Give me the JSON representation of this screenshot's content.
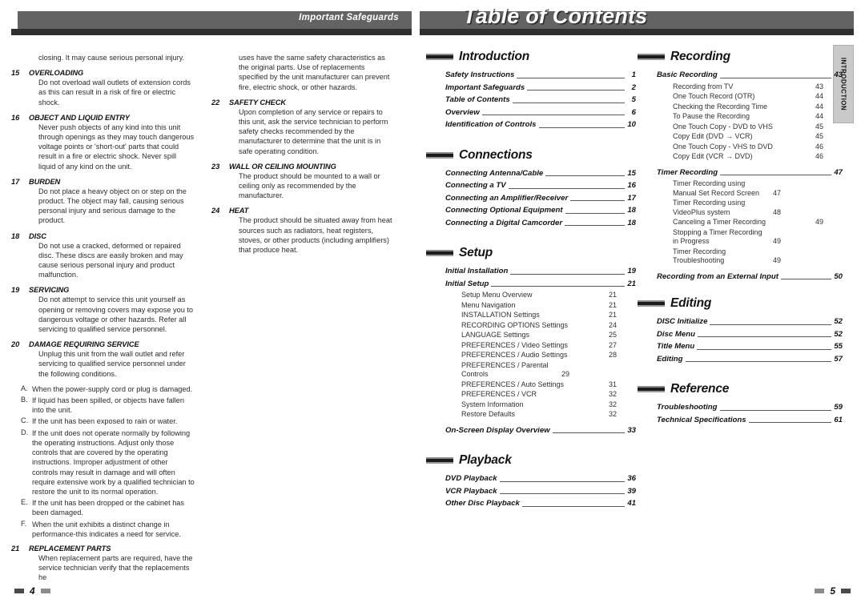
{
  "headers": {
    "left_title": "Important Safeguards",
    "right_title": "Table of Contents"
  },
  "side_tab": {
    "label": "INTRODUCTION"
  },
  "footers": {
    "left_page": "4",
    "right_page": "5"
  },
  "safeguards": {
    "col1": {
      "intro_text": "closing. It may cause serious personal injury.",
      "items": [
        {
          "num": "15",
          "head": "OVERLOADING",
          "body": "Do not overload wall outlets of extension cords as this can result in a risk of fire or electric shock."
        },
        {
          "num": "16",
          "head": "OBJECT AND LIQUID ENTRY",
          "body": "Never push objects of any kind into this unit through openings as they may touch dangerous voltage points or 'short-out' parts that could result in a fire or electric shock. Never spill liquid of any kind on the unit."
        },
        {
          "num": "17",
          "head": "BURDEN",
          "body": "Do not place a heavy object on or step on the product. The object may fall, causing serious personal injury and serious damage to the product."
        },
        {
          "num": "18",
          "head": "DISC",
          "body": "Do not use a cracked, deformed or repaired disc. These discs are easily broken and may cause serious personal injury and product malfunction."
        },
        {
          "num": "19",
          "head": "SERVICING",
          "body": "Do not attempt to service this unit yourself as opening or removing covers may expose you to dangerous voltage or other hazards. Refer all servicing to qualified service personnel."
        },
        {
          "num": "20",
          "head": "DAMAGE REQUIRING SERVICE",
          "body": "Unplug this unit from the wall outlet and refer servicing to qualified service personnel under the following conditions."
        }
      ],
      "sub_items": [
        {
          "letter": "A.",
          "text": "When the power-supply cord or plug is damaged."
        },
        {
          "letter": "B.",
          "text": "If liquid has been spilled, or objects have fallen into the unit."
        },
        {
          "letter": "C.",
          "text": "If the unit has been exposed to rain or water."
        },
        {
          "letter": "D.",
          "text": "If the unit does not operate normally by following the operating instructions. Adjust only those controls that are covered by the operating instructions. Improper adjustment of other controls may result in damage and will often require extensive work by a qualified technician to restore the unit to its normal operation."
        },
        {
          "letter": "E.",
          "text": "If the unit has been dropped or the cabinet has been damaged."
        },
        {
          "letter": "F.",
          "text": "When the unit exhibits a distinct change in performance-this indicates a need for service."
        }
      ],
      "last_item": {
        "num": "21",
        "head": "REPLACEMENT PARTS",
        "body": "When replacement parts are required, have the service technician verify that the replacements he"
      }
    },
    "col2": {
      "intro_text": "uses have the same safety characteristics as the original parts. Use of replacements specified by the unit manufacturer can prevent fire, electric shock, or other hazards.",
      "items": [
        {
          "num": "22",
          "head": "SAFETY CHECK",
          "body": "Upon completion of any service or repairs to this unit, ask the service technician to perform safety checks recommended by the manufacturer to determine that the unit is in safe operating condition."
        },
        {
          "num": "23",
          "head": "WALL OR CEILING MOUNTING",
          "body": "The product should be mounted to a wall or ceiling only as recommended by the manufacturer."
        },
        {
          "num": "24",
          "head": "HEAT",
          "body": "The product should be situated away from heat sources such as radiators, heat registers, stoves, or other products (including amplifiers) that produce heat."
        }
      ]
    }
  },
  "toc": {
    "sections": [
      {
        "title": "Introduction",
        "entries": [
          {
            "label": "Safety Instructions",
            "page": "1"
          },
          {
            "label": "Important Safeguards",
            "page": "2"
          },
          {
            "label": "Table of Contents",
            "page": "5"
          },
          {
            "label": "Overview",
            "page": "6"
          },
          {
            "label": "Identification of Controls",
            "page": "10"
          }
        ]
      },
      {
        "title": "Connections",
        "entries": [
          {
            "label": "Connecting Antenna/Cable",
            "page": "15"
          },
          {
            "label": "Connecting a TV",
            "page": "16"
          },
          {
            "label": "Connecting an Amplifier/Receiver",
            "page": "17"
          },
          {
            "label": "Connecting Optional Equipment",
            "page": "18"
          },
          {
            "label": "Connecting a Digital Camcorder",
            "page": "18"
          }
        ]
      },
      {
        "title": "Setup",
        "entries": [
          {
            "label": "Initial Installation",
            "page": "19"
          },
          {
            "label": "Initial Setup",
            "page": "21"
          }
        ],
        "subentries": [
          {
            "label": "Setup Menu Overview",
            "page": "21"
          },
          {
            "label": "Menu Navigation",
            "page": "21"
          },
          {
            "label": "INSTALLATION Settings",
            "page": "21"
          },
          {
            "label": "RECORDING OPTIONS Settings",
            "page": "24"
          },
          {
            "label": "LANGUAGE Settings",
            "page": "25"
          },
          {
            "label": "PREFERENCES / Video Settings",
            "page": "27"
          },
          {
            "label": "PREFERENCES / Audio Settings",
            "page": "28"
          },
          {
            "label": "PREFERENCES / Parental Controls",
            "page": "29"
          },
          {
            "label": "PREFERENCES / Auto Settings",
            "page": "31"
          },
          {
            "label": "PREFERENCES / VCR",
            "page": "32"
          },
          {
            "label": "System Information",
            "page": "32"
          },
          {
            "label": "Restore Defaults",
            "page": "32"
          }
        ],
        "trailing_entries": [
          {
            "label": "On-Screen Display Overview",
            "page": "33"
          }
        ]
      },
      {
        "title": "Playback",
        "entries": [
          {
            "label": "DVD Playback",
            "page": "36"
          },
          {
            "label": "VCR Playback",
            "page": "39"
          },
          {
            "label": "Other Disc Playback",
            "page": "41"
          }
        ]
      },
      {
        "title": "Recording",
        "entries": [
          {
            "label": "Basic Recording",
            "page": "43"
          }
        ],
        "subentries": [
          {
            "label": "Recording from TV",
            "page": "43"
          },
          {
            "label": "One Touch Record (OTR)",
            "page": "44"
          },
          {
            "label": "Checking the Recording Time",
            "page": "44"
          },
          {
            "label": "To Pause the Recording",
            "page": "44"
          },
          {
            "label": "One Touch Copy - DVD to VHS",
            "page": "45"
          },
          {
            "label": "Copy Edit (DVD → VCR)",
            "page": "45"
          },
          {
            "label": "One Touch Copy - VHS to DVD",
            "page": "46"
          },
          {
            "label": "Copy Edit (VCR → DVD)",
            "page": "46"
          }
        ],
        "entries2": [
          {
            "label": "Timer Recording",
            "page": "47"
          }
        ],
        "subentries2": [
          {
            "label": "Timer Recording using Manual Set Record Screen",
            "page": "47"
          },
          {
            "label": "Timer Recording using VideoPlus system",
            "page": "48"
          },
          {
            "label": "Canceling a Timer Recording",
            "page": "49"
          },
          {
            "label": "Stopping a Timer Recording in Progress",
            "page": "49"
          },
          {
            "label": "Timer Recording Troubleshooting",
            "page": "49"
          }
        ],
        "trailing_entries": [
          {
            "label": "Recording from an External Input",
            "page": "50"
          }
        ]
      },
      {
        "title": "Editing",
        "entries": [
          {
            "label": "DISC Initialize",
            "page": "52"
          },
          {
            "label": "Disc Menu",
            "page": "52"
          },
          {
            "label": "Title Menu",
            "page": "55"
          },
          {
            "label": "Editing",
            "page": "57"
          }
        ]
      },
      {
        "title": "Reference",
        "entries": [
          {
            "label": "Troubleshooting",
            "page": "59"
          },
          {
            "label": "Technical Specifications",
            "page": "61"
          }
        ]
      }
    ]
  }
}
